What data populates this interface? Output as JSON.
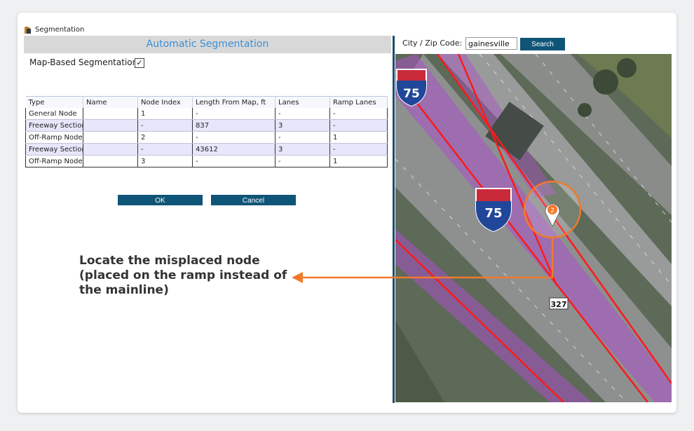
{
  "window": {
    "title": "Segmentation"
  },
  "panel": {
    "header": "Automatic Segmentation",
    "map_based_label": "Map-Based Segmentation",
    "map_based_checked": "✓"
  },
  "table": {
    "headers": [
      "Type",
      "Name",
      "Node Index",
      "Length From Map, ft",
      "Lanes",
      "Ramp Lanes"
    ],
    "rows": [
      [
        "General Node",
        "",
        "1",
        "-",
        "-",
        "-"
      ],
      [
        "Freeway Section",
        "",
        "-",
        "837",
        "3",
        "-"
      ],
      [
        "Off-Ramp Node",
        "",
        "2",
        "-",
        "-",
        "1"
      ],
      [
        "Freeway Section",
        "",
        "-",
        "43612",
        "3",
        "-"
      ],
      [
        "Off-Ramp Node",
        "",
        "3",
        "-",
        "-",
        "1"
      ]
    ]
  },
  "buttons": {
    "ok": "OK",
    "cancel": "Cancel"
  },
  "map_search": {
    "label": "City / Zip Code:",
    "value": "gainesville",
    "button": "Search"
  },
  "map": {
    "shields": [
      "75",
      "75"
    ],
    "road_label": "327",
    "marker_label": "2"
  },
  "annotation": {
    "line1": "Locate the misplaced node",
    "line2": "(placed on the ramp instead of",
    "line3": "the mainline)"
  },
  "colors": {
    "accent": "#f07a2c",
    "header_text": "#3d8fd6",
    "button": "#0f5577",
    "segment_line": "#ff1a1a"
  }
}
